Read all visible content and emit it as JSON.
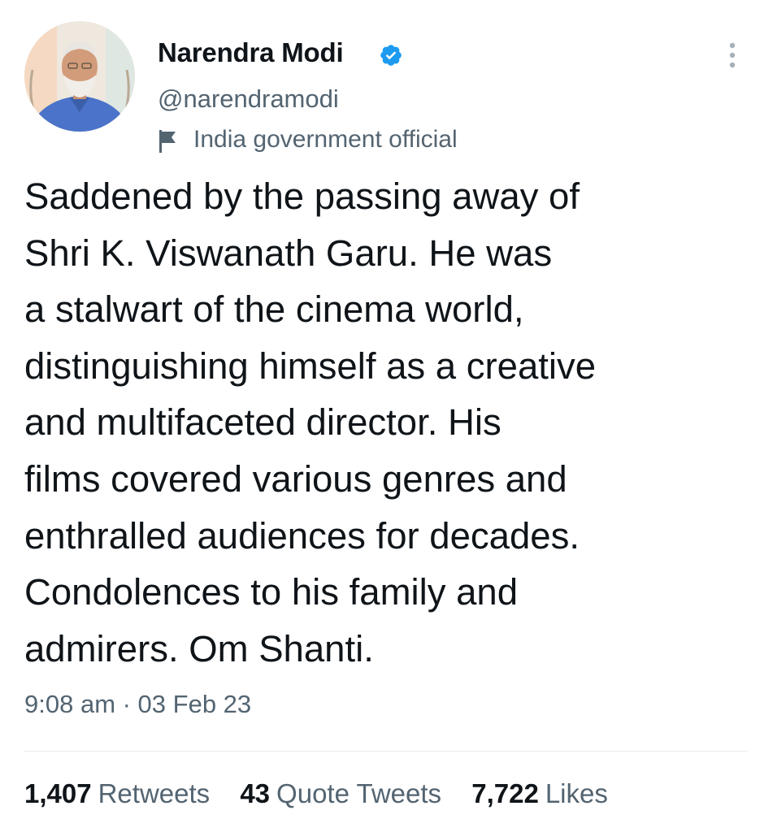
{
  "author": {
    "name": "Narendra Modi",
    "handle": "@narendramodi",
    "label": "India government official",
    "verified": true
  },
  "tweet": {
    "lines": [
      "Saddened by the passing away of",
      "Shri K. Viswanath Garu. He was",
      "a stalwart of the cinema world,",
      "distinguishing himself as a creative",
      "and multifaceted director. His",
      "films covered various genres and",
      "enthralled audiences for decades.",
      "Condolences to his family and",
      "admirers. Om Shanti."
    ],
    "timestamp": "9:08 am · 03 Feb 23"
  },
  "stats": {
    "retweets_count": "1,407",
    "retweets_label": "Retweets",
    "quotes_count": "43",
    "quotes_label": "Quote Tweets",
    "likes_count": "7,722",
    "likes_label": "Likes"
  },
  "icons": {
    "verified": "verified-badge-icon",
    "label": "flag-icon",
    "more": "more-vertical-icon"
  },
  "colors": {
    "primary_text": "#0f1419",
    "secondary_text": "#536471",
    "verified_blue": "#1d9bf0",
    "divider": "#e6ecf0"
  }
}
